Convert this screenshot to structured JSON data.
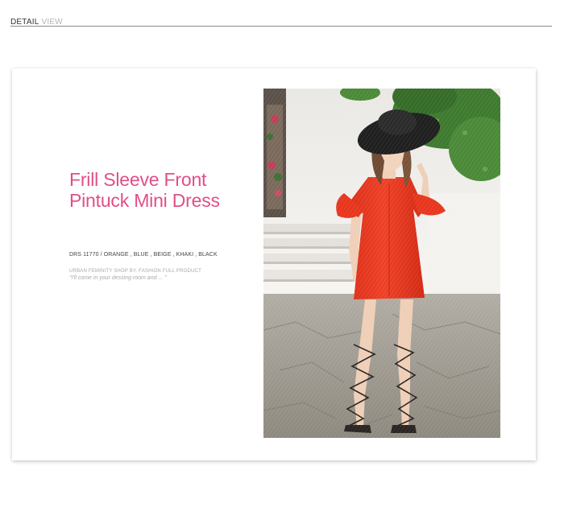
{
  "header": {
    "label_primary": "DETAIL",
    "label_secondary": "VIEW"
  },
  "product": {
    "title": "Frill Sleeve Front Pintuck Mini Dress",
    "code_line": "DRS 11770 / ORANGE , BLUE , BEIGE , KHAKI , BLACK",
    "tagline": "URBAN FEMINITY SHOP BY. FASHION FULL PRODUCT",
    "quote": "\"I'll come in your dessing room and ... \""
  },
  "photo": {
    "subject": "model-in-orange-dress-and-black-hat",
    "colors": {
      "dress": "#e8361e",
      "hat": "#1f1f1f",
      "wall": "#f2f1ef",
      "foliage": "#3e7a2f",
      "ground": "#9a958c"
    }
  },
  "colors": {
    "title": "#e04f86",
    "header_rule": "#8a8a8a",
    "muted_text": "#a9a9a9"
  }
}
